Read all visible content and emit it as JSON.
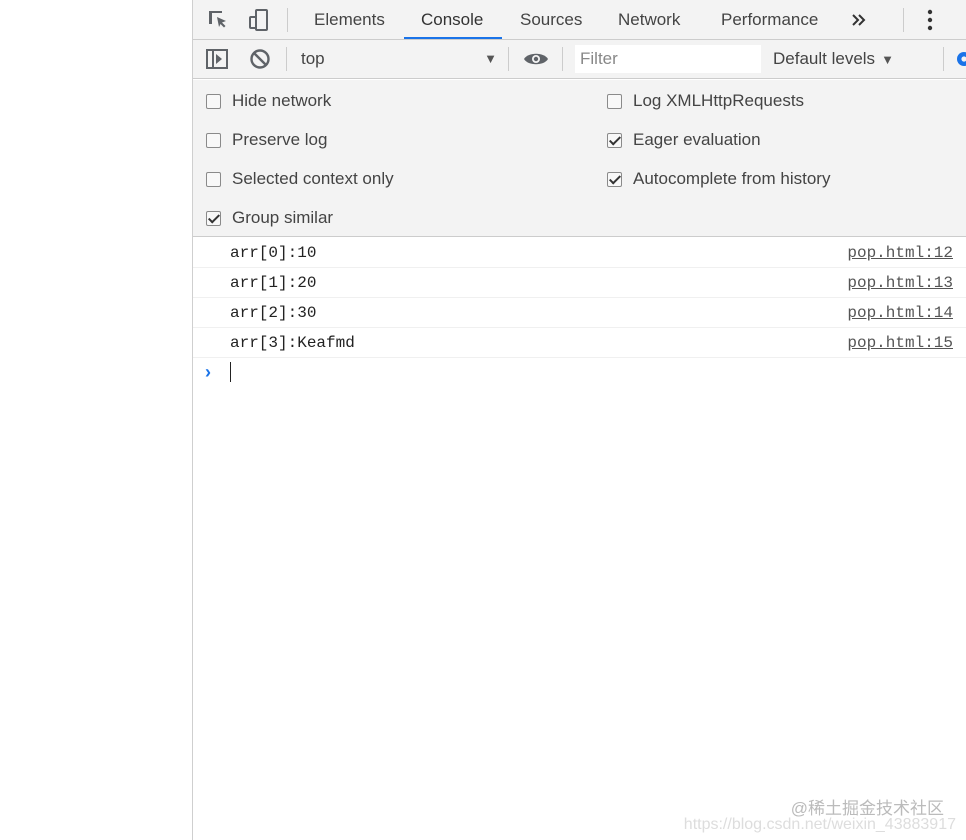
{
  "tabs": [
    {
      "label": "Elements"
    },
    {
      "label": "Console"
    },
    {
      "label": "Sources"
    },
    {
      "label": "Network"
    },
    {
      "label": "Performance"
    }
  ],
  "tabbar": {
    "more_tabs_icon": "double-chevron-right-icon",
    "menu_icon": "kebab-menu-icon"
  },
  "toolbar": {
    "context": "top",
    "filter_placeholder": "Filter",
    "levels": "Default levels"
  },
  "settings": {
    "left": [
      {
        "label": "Hide network",
        "checked": false
      },
      {
        "label": "Preserve log",
        "checked": false
      },
      {
        "label": "Selected context only",
        "checked": false
      },
      {
        "label": "Group similar",
        "checked": true
      }
    ],
    "right": [
      {
        "label": "Log XMLHttpRequests",
        "checked": false
      },
      {
        "label": "Eager evaluation",
        "checked": true
      },
      {
        "label": "Autocomplete from history",
        "checked": true
      }
    ]
  },
  "messages": [
    {
      "text": "arr[0]:10",
      "source": "pop.html:12"
    },
    {
      "text": "arr[1]:20",
      "source": "pop.html:13"
    },
    {
      "text": "arr[2]:30",
      "source": "pop.html:14"
    },
    {
      "text": "arr[3]:Keafmd",
      "source": "pop.html:15"
    }
  ],
  "prompt": {
    "symbol": "›"
  },
  "watermark": {
    "line1": "@稀土掘金技术社区",
    "line2": "https://blog.csdn.net/weixin_43883917"
  },
  "colors": {
    "accent": "#1a73e8",
    "toolbar_bg": "#f3f3f3",
    "border": "#cccccc"
  }
}
